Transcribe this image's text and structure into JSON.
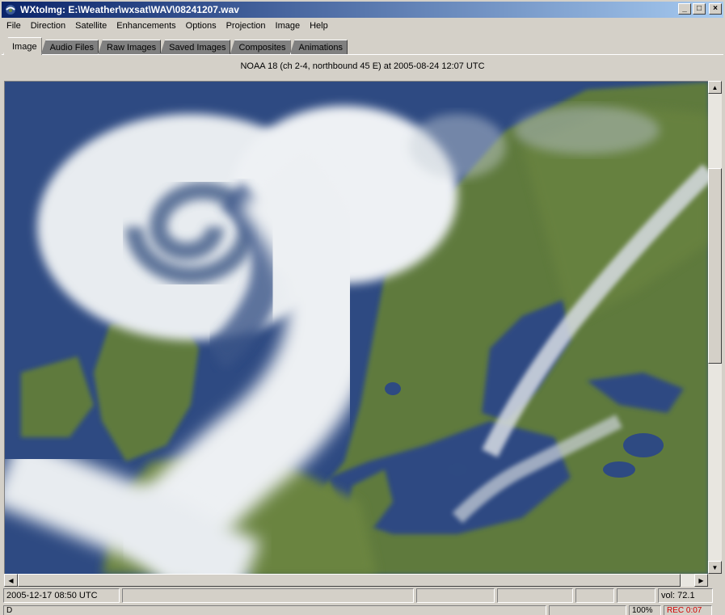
{
  "window": {
    "title": "WXtoImg: E:\\Weather\\wxsat\\WAV\\08241207.wav",
    "minimize_label": "_",
    "maximize_label": "□",
    "close_label": "×"
  },
  "menu": {
    "items": [
      "File",
      "Direction",
      "Satellite",
      "Enhancements",
      "Options",
      "Projection",
      "Image",
      "Help"
    ]
  },
  "tabs": {
    "items": [
      "Image",
      "Audio Files",
      "Raw Images",
      "Saved Images",
      "Composites",
      "Animations"
    ],
    "active": "Image"
  },
  "image": {
    "caption": "NOAA 18 (ch 2-4, northbound 45 E) at 2005-08-24  12:07 UTC"
  },
  "scroll": {
    "up": "▲",
    "down": "▼",
    "left": "◀",
    "right": "▶"
  },
  "statusbar": {
    "datetime": "2005-12-17  08:50 UTC",
    "volume": "vol: 72.1",
    "line2_left": "D",
    "zoom": "100%",
    "rec": "REC 0:07"
  },
  "colors": {
    "titlebar_start": "#0a246a",
    "titlebar_end": "#a6caf0",
    "ocean": "#2e4a82",
    "land": "#5e7a3c",
    "cloud": "#e8ecf0",
    "rec_text": "#d00000"
  }
}
